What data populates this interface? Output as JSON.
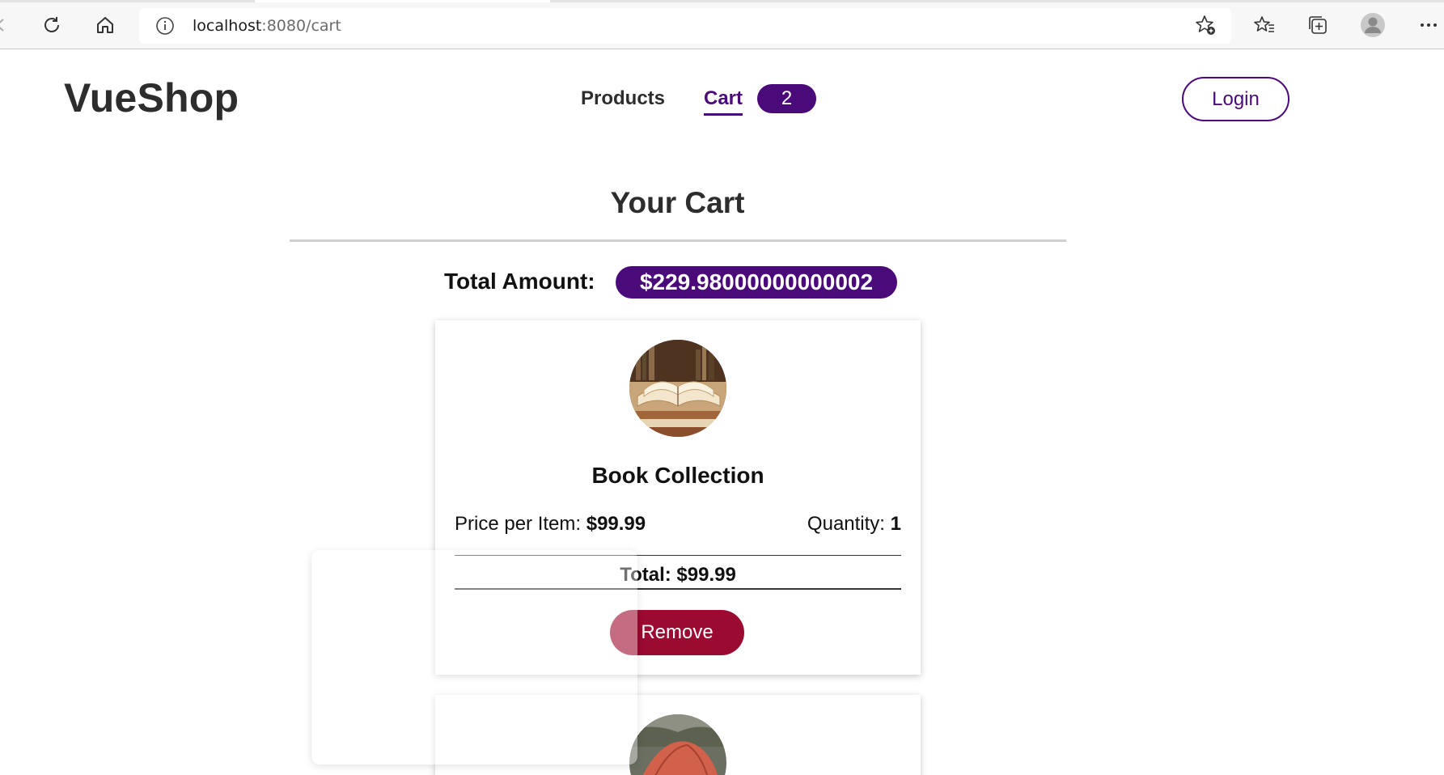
{
  "browser": {
    "url_host": "localhost",
    "url_path": ":8080/cart"
  },
  "navbar": {
    "brand": "VueShop",
    "links": [
      {
        "label": "Products",
        "active": false
      },
      {
        "label": "Cart",
        "active": true
      }
    ],
    "cart_count": "2",
    "login_label": "Login"
  },
  "cart": {
    "title": "Your Cart",
    "total_label": "Total Amount:",
    "total_value": "$229.98000000000002",
    "items": [
      {
        "image": "open-books-photo",
        "name": "Book Collection",
        "price_label": "Price per Item:",
        "price": "$99.99",
        "quantity_label": "Quantity:",
        "quantity": "1",
        "total_text": "Total: $99.99",
        "remove_label": "Remove"
      },
      {
        "image": "red-tent-photo"
      }
    ]
  },
  "colors": {
    "accent": "#4b0a7a",
    "danger": "#9b0a30",
    "text": "#2d2d2d"
  }
}
